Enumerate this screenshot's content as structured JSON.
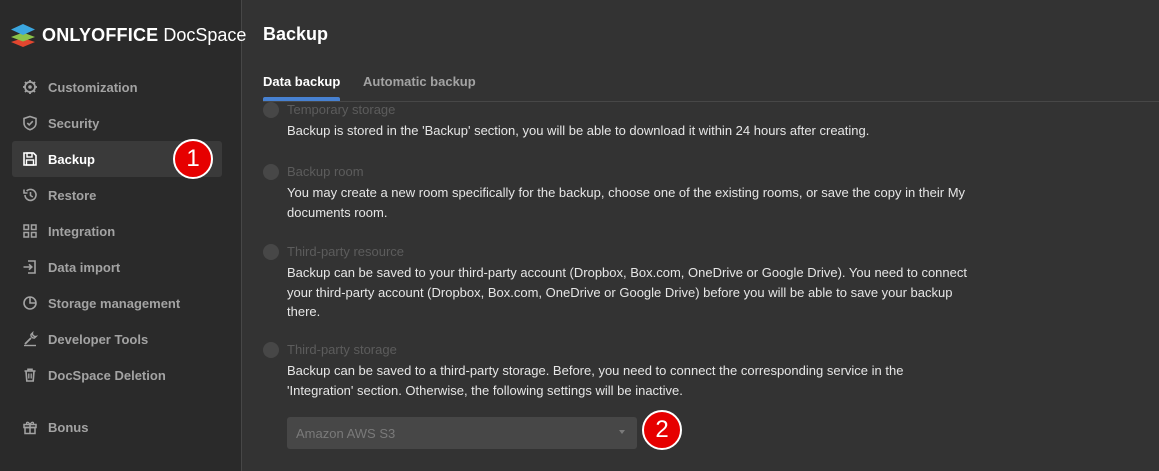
{
  "app": {
    "brand": "ONLYOFFICE",
    "product": "DocSpace"
  },
  "sidebar": {
    "items": [
      {
        "label": "Customization",
        "icon": "gear-icon",
        "active": false
      },
      {
        "label": "Security",
        "icon": "shield-icon",
        "active": false
      },
      {
        "label": "Backup",
        "icon": "save-icon",
        "active": true
      },
      {
        "label": "Restore",
        "icon": "history-icon",
        "active": false
      },
      {
        "label": "Integration",
        "icon": "grid-icon",
        "active": false
      },
      {
        "label": "Data import",
        "icon": "import-icon",
        "active": false
      },
      {
        "label": "Storage management",
        "icon": "database-icon",
        "active": false
      },
      {
        "label": "Developer Tools",
        "icon": "tools-icon",
        "active": false
      },
      {
        "label": "DocSpace Deletion",
        "icon": "trash-icon",
        "active": false
      },
      {
        "label": "Bonus",
        "icon": "gift-icon",
        "active": false
      }
    ]
  },
  "main": {
    "title": "Backup",
    "tabs": [
      {
        "label": "Data backup",
        "active": true
      },
      {
        "label": "Automatic backup",
        "active": false
      }
    ],
    "options": [
      {
        "label": "Temporary storage",
        "description": "Backup is stored in the 'Backup' section, you will be able to download it within 24 hours after creating."
      },
      {
        "label": "Backup room",
        "description": "You may create a new room specifically for the backup, choose one of the existing rooms, or save the copy in their My documents room."
      },
      {
        "label": "Third-party resource",
        "description": "Backup can be saved to your third-party account (Dropbox, Box.com, OneDrive or Google Drive). You need to connect your third-party account (Dropbox, Box.com, OneDrive or Google Drive) before you will be able to save your backup there."
      },
      {
        "label": "Third-party storage",
        "description": "Backup can be saved to a third-party storage. Before, you need to connect the corresponding service in the 'Integration' section. Otherwise, the following settings will be inactive."
      }
    ],
    "storage_select": {
      "value": "Amazon AWS S3"
    }
  },
  "callouts": [
    "1",
    "2"
  ],
  "colors": {
    "accent": "#4781d1",
    "callout": "#e60000",
    "sidebar_bg": "#2a2a2a",
    "main_bg": "#333333"
  }
}
